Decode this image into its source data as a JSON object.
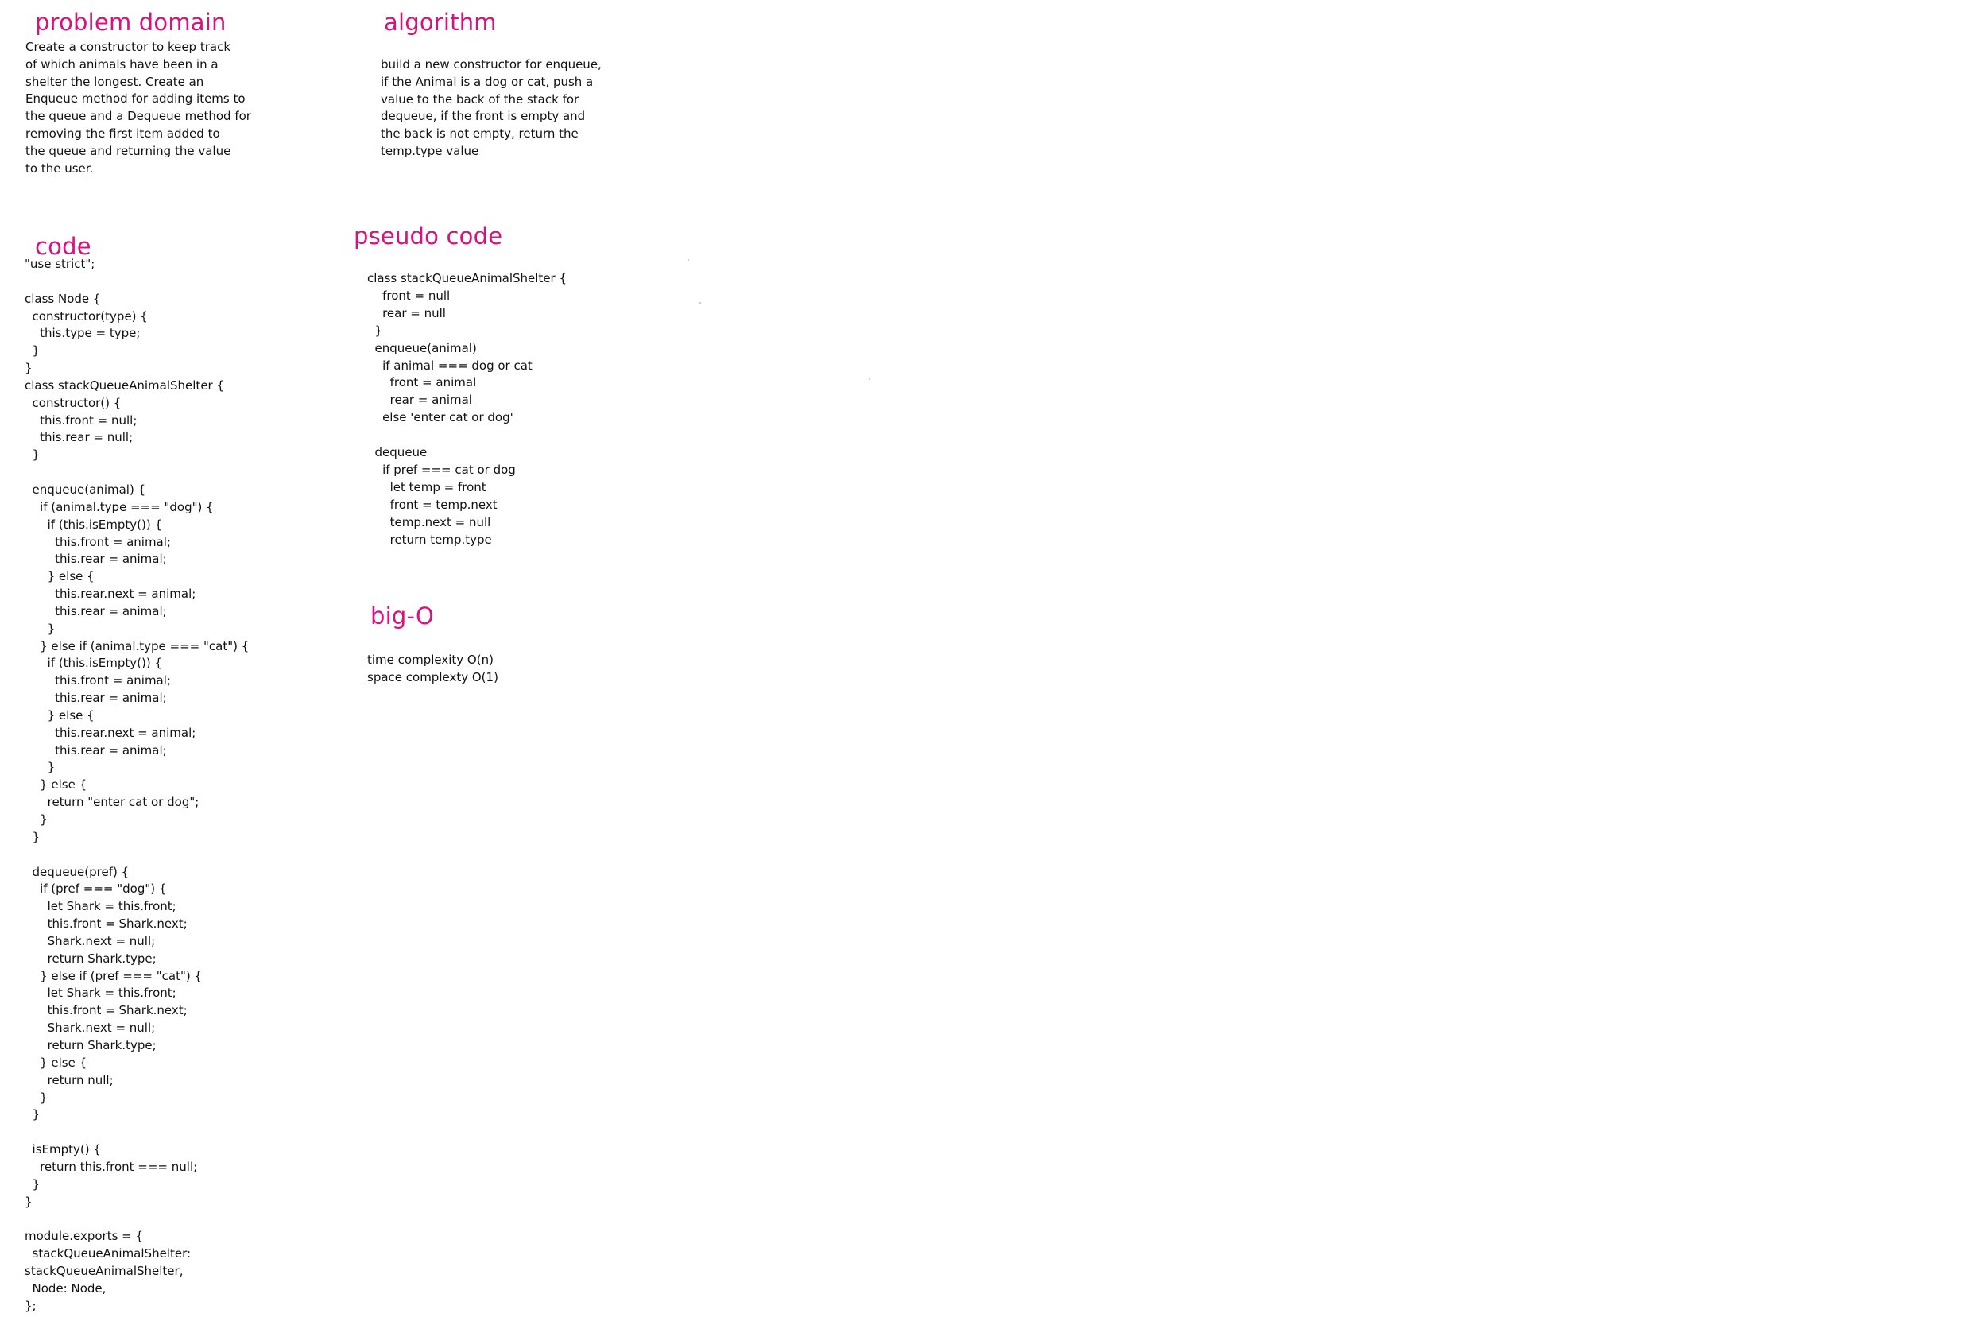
{
  "accent_color": "#d6127f",
  "sections": {
    "problem_domain": {
      "heading": "problem domain",
      "lines": [
        "Create a constructor to keep track",
        "of which animals have been in a",
        "shelter the longest. Create an",
        "Enqueue method for adding items to",
        "the queue and a Dequeue method for",
        "removing the first item added to",
        "the queue and returning the value",
        "to the user."
      ]
    },
    "algorithm": {
      "heading": "algorithm",
      "lines": [
        "build a new constructor for enqueue,",
        "if the Animal is a dog or cat, push a",
        "value to the back of the stack for",
        "dequeue, if the front is empty and",
        "the back is not empty, return the",
        "temp.type value"
      ]
    },
    "code": {
      "heading": "code",
      "lines": [
        "\"use strict\";",
        "",
        "class Node {",
        "  constructor(type) {",
        "    this.type = type;",
        "  }",
        "}",
        "class stackQueueAnimalShelter {",
        "  constructor() {",
        "    this.front = null;",
        "    this.rear = null;",
        "  }",
        "",
        "  enqueue(animal) {",
        "    if (animal.type === \"dog\") {",
        "      if (this.isEmpty()) {",
        "        this.front = animal;",
        "        this.rear = animal;",
        "      } else {",
        "        this.rear.next = animal;",
        "        this.rear = animal;",
        "      }",
        "    } else if (animal.type === \"cat\") {",
        "      if (this.isEmpty()) {",
        "        this.front = animal;",
        "        this.rear = animal;",
        "      } else {",
        "        this.rear.next = animal;",
        "        this.rear = animal;",
        "      }",
        "    } else {",
        "      return \"enter cat or dog\";",
        "    }",
        "  }",
        "",
        "  dequeue(pref) {",
        "    if (pref === \"dog\") {",
        "      let Shark = this.front;",
        "      this.front = Shark.next;",
        "      Shark.next = null;",
        "      return Shark.type;",
        "    } else if (pref === \"cat\") {",
        "      let Shark = this.front;",
        "      this.front = Shark.next;",
        "      Shark.next = null;",
        "      return Shark.type;",
        "    } else {",
        "      return null;",
        "    }",
        "  }",
        "",
        "  isEmpty() {",
        "    return this.front === null;",
        "  }",
        "}",
        "",
        "module.exports = {",
        "  stackQueueAnimalShelter:",
        "stackQueueAnimalShelter,",
        "  Node: Node,",
        "};"
      ]
    },
    "pseudo_code": {
      "heading": "pseudo code",
      "lines": [
        "class stackQueueAnimalShelter {",
        "    front = null",
        "    rear = null",
        "  }",
        "  enqueue(animal)",
        "    if animal === dog or cat",
        "      front = animal",
        "      rear = animal",
        "    else 'enter cat or dog'",
        "",
        "  dequeue",
        "    if pref === cat or dog",
        "      let temp = front",
        "      front = temp.next",
        "      temp.next = null",
        "      return temp.type"
      ]
    },
    "big_o": {
      "heading": "big-O",
      "lines": [
        "time complexity O(n)",
        "space complexty O(1)"
      ]
    }
  }
}
